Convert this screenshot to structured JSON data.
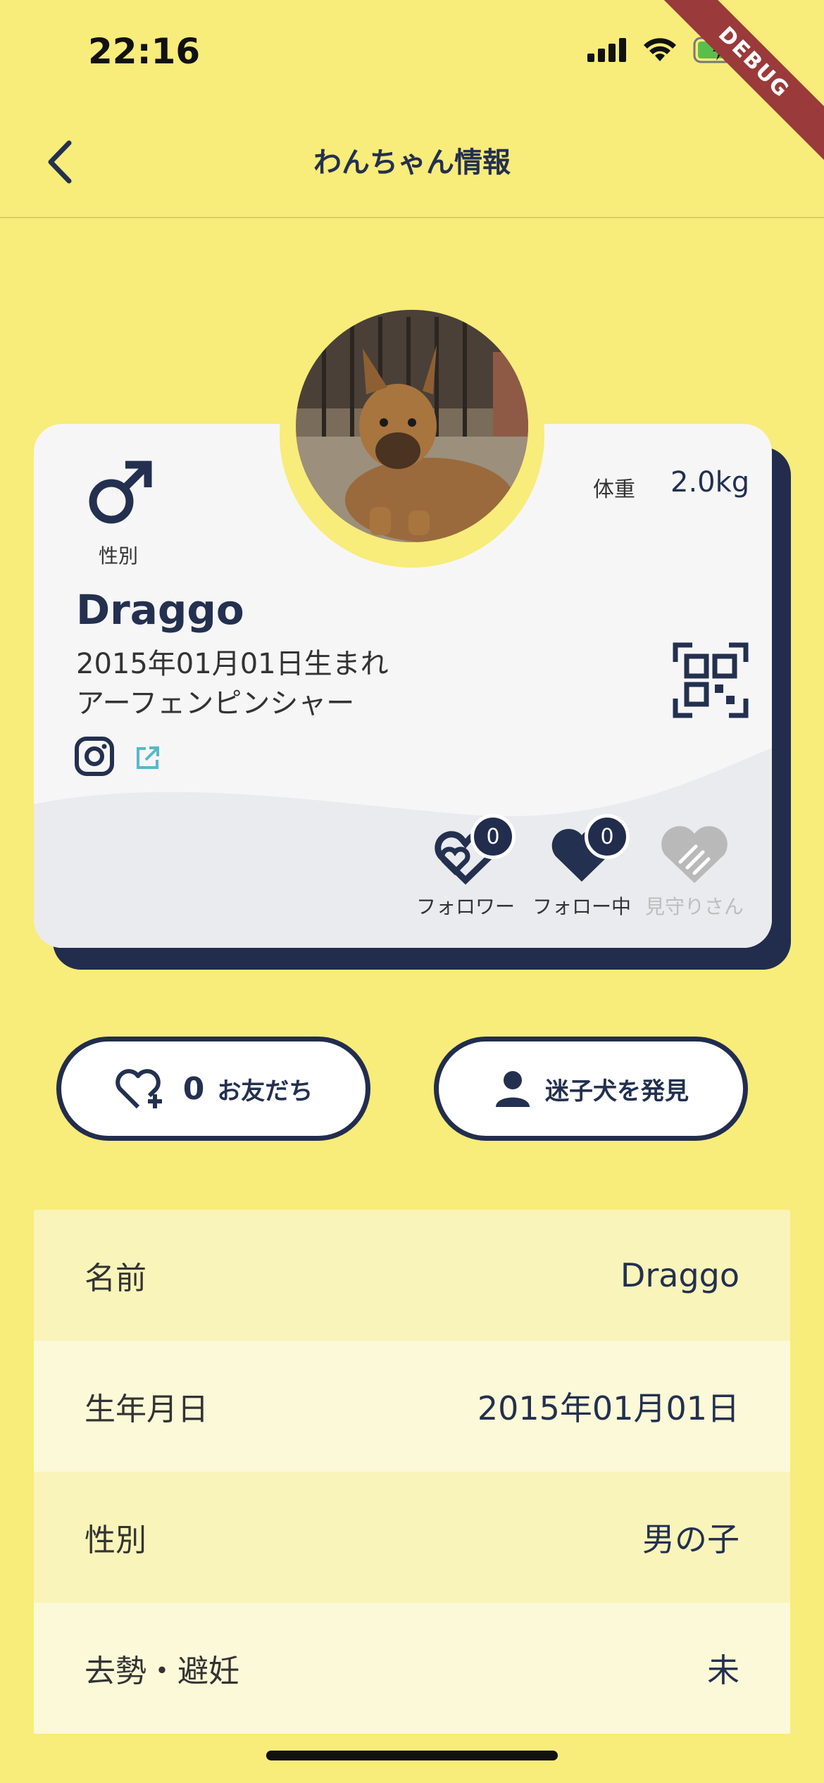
{
  "status_bar": {
    "time": "22:16",
    "debug_label": "DEBUG"
  },
  "header": {
    "title": "わんちゃん情報"
  },
  "profile": {
    "gender_label": "性別",
    "weight_label": "体重",
    "weight_value": "2.0kg",
    "name": "Draggo",
    "birth": "2015年01月01日生まれ",
    "breed": "アーフェンピンシャー"
  },
  "stats": [
    {
      "label": "フォロワー",
      "count": "0"
    },
    {
      "label": "フォロー中",
      "count": "0"
    },
    {
      "label": "見守りさん"
    }
  ],
  "buttons": {
    "friends_count": "0",
    "friends_label": "お友だち",
    "lost_dog_label": "迷子犬を発見"
  },
  "info_rows": [
    {
      "label": "名前",
      "value": "Draggo"
    },
    {
      "label": "生年月日",
      "value": "2015年01月01日"
    },
    {
      "label": "性別",
      "value": "男の子"
    },
    {
      "label": "去勢・避妊",
      "value": "未"
    }
  ],
  "colors": {
    "background": "#F8EC7A",
    "navy": "#222D4E",
    "card": "#F6F6F7"
  }
}
